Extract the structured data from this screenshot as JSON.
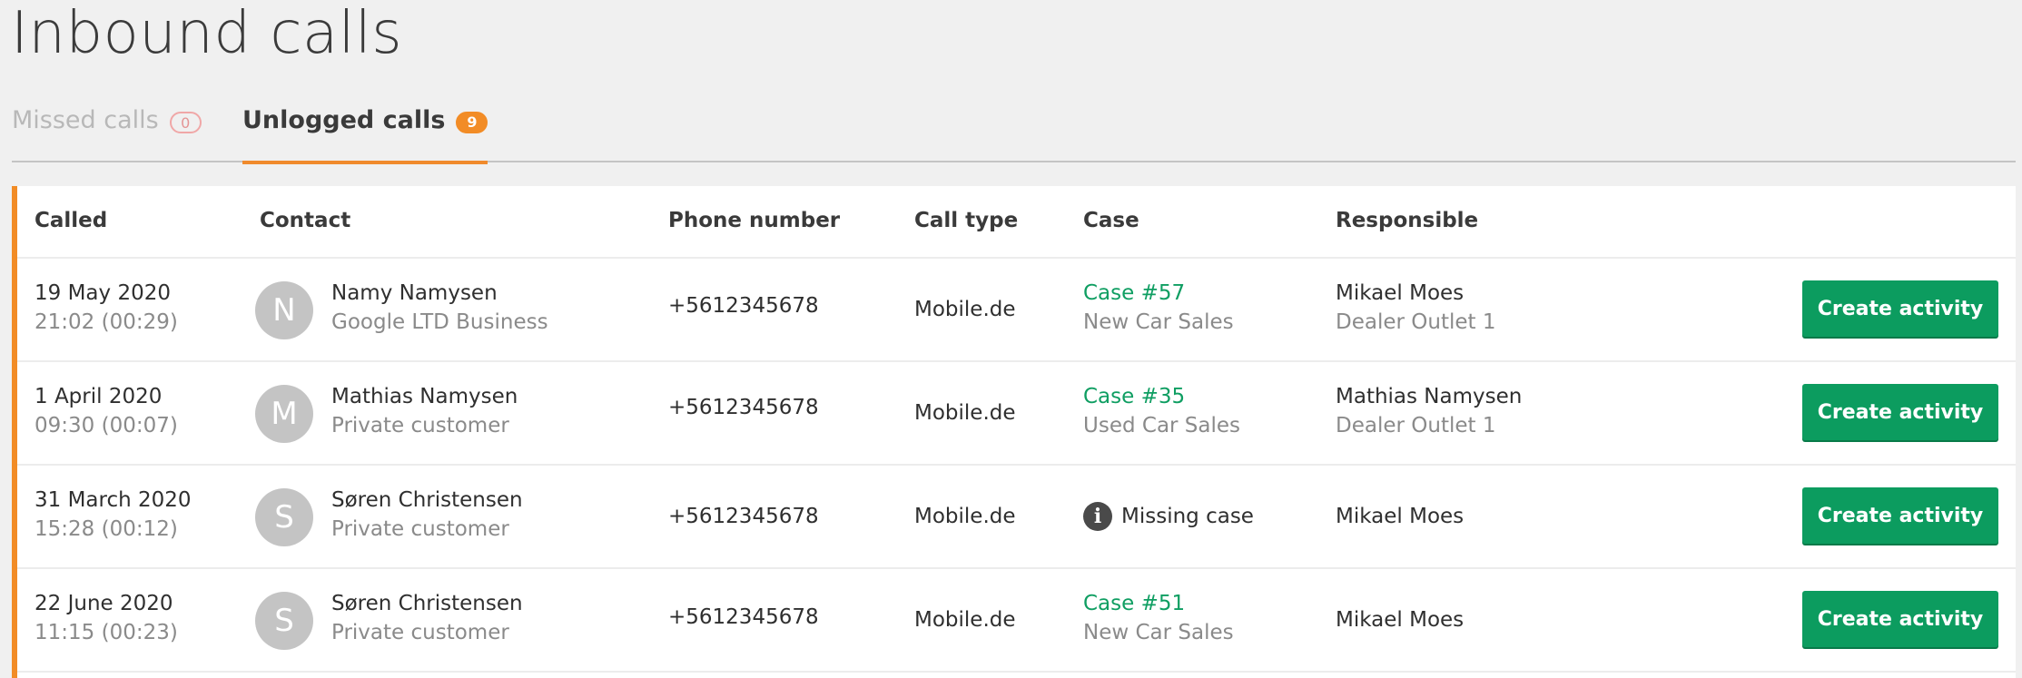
{
  "page": {
    "title": "Inbound calls"
  },
  "tabs": [
    {
      "label": "Missed calls",
      "count": "0"
    },
    {
      "label": "Unlogged calls",
      "count": "9"
    }
  ],
  "table": {
    "headers": {
      "called": "Called",
      "contact": "Contact",
      "phone": "Phone number",
      "call_type": "Call type",
      "case": "Case",
      "responsible": "Responsible"
    },
    "rows": [
      {
        "date": "19 May 2020",
        "time": "21:02 (00:29)",
        "avatar": "N",
        "contact_name": "Namy Namysen",
        "contact_sub": "Google LTD Business",
        "phone": "+5612345678",
        "call_type": "Mobile.de",
        "case_link": "Case #57",
        "case_sub": "New Car Sales",
        "missing_case": "",
        "responsible": "Mikael Moes",
        "responsible_sub": "Dealer Outlet 1",
        "action": "Create activity"
      },
      {
        "date": "1 April 2020",
        "time": "09:30 (00:07)",
        "avatar": "M",
        "contact_name": "Mathias Namysen",
        "contact_sub": "Private customer",
        "phone": "+5612345678",
        "call_type": "Mobile.de",
        "case_link": "Case #35",
        "case_sub": "Used Car Sales",
        "missing_case": "",
        "responsible": "Mathias Namysen",
        "responsible_sub": "Dealer Outlet 1",
        "action": "Create activity"
      },
      {
        "date": "31 March 2020",
        "time": "15:28 (00:12)",
        "avatar": "S",
        "contact_name": "Søren Christensen",
        "contact_sub": "Private customer",
        "phone": "+5612345678",
        "call_type": "Mobile.de",
        "case_link": "",
        "case_sub": "",
        "missing_case": "Missing case",
        "responsible": "Mikael Moes",
        "responsible_sub": "",
        "action": "Create activity"
      },
      {
        "date": "22 June 2020",
        "time": "11:15 (00:23)",
        "avatar": "S",
        "contact_name": "Søren Christensen",
        "contact_sub": "Private customer",
        "phone": "+5612345678",
        "call_type": "Mobile.de",
        "case_link": "Case #51",
        "case_sub": "New Car Sales",
        "missing_case": "",
        "responsible": "Mikael Moes",
        "responsible_sub": "",
        "action": "Create activity"
      }
    ]
  },
  "icons": {
    "missing_case": "info-icon"
  },
  "colors": {
    "accent": "#f28c26",
    "link": "#0f9e62",
    "button": "#0c9c5f"
  }
}
